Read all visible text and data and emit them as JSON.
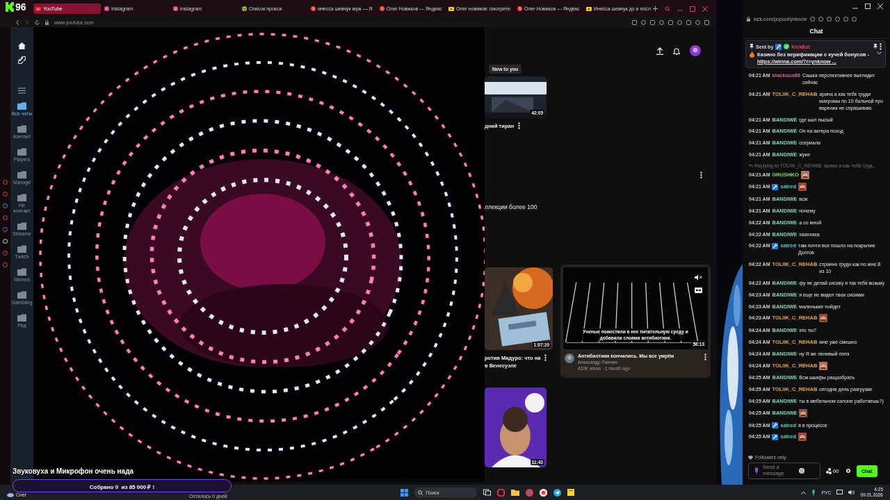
{
  "stream_overlay": {
    "viewers": "96",
    "goal_title": "Звуковуха и Микрофон очень нада",
    "goal_bar": {
      "text": "Собрано 0  из 85 000 ₽ !",
      "level": 0
    },
    "goal_remaining": "Осталось 0 дней"
  },
  "browser": {
    "tabs": [
      {
        "kind": "youtube",
        "label": "YouTube",
        "selected": true
      },
      {
        "kind": "instagram",
        "label": "Instagram",
        "selected": false
      },
      {
        "kind": "instagram",
        "label": "Instagram",
        "selected": false
      },
      {
        "kind": "proxy",
        "label": "Список прокси",
        "selected": false
      },
      {
        "kind": "yandex",
        "label": "инесса шевчук муж — Я",
        "selected": false
      },
      {
        "kind": "yandex",
        "label": "Олег Новиков — Яндекс",
        "selected": false
      },
      {
        "kind": "video",
        "label": "Олег новиков: смотрите",
        "selected": false
      },
      {
        "kind": "yandex",
        "label": "Олег Новиков — Яндекс",
        "selected": false
      },
      {
        "kind": "video",
        "label": "Инесса шевчук до и посл",
        "selected": false
      }
    ],
    "address": "www.youtube.com"
  },
  "messenger_sidebar": {
    "folders": [
      {
        "label": "Все чаты",
        "selected": true
      },
      {
        "label": "Контакт",
        "selected": false
      },
      {
        "label": "Players",
        "selected": false
      },
      {
        "label": "Manage",
        "selected": false
      },
      {
        "label": "Не контакт",
        "selected": false
      },
      {
        "label": "Streame",
        "selected": false
      },
      {
        "label": "Twitch",
        "selected": false
      },
      {
        "label": "Memes",
        "selected": false
      },
      {
        "label": "Gambling",
        "selected": false
      },
      {
        "label": "Ред",
        "selected": false
      }
    ]
  },
  "youtube": {
    "chip": "New to you",
    "videos": [
      {
        "duration": "42:05",
        "title_lines": [
          "дний тиран"
        ]
      },
      {
        "duration": "1:07:20",
        "title_lines": [
          "ротив Мадуро: что на",
          "в Венесуэле"
        ]
      },
      {
        "duration": "11:43"
      }
    ],
    "partial_text": "ллекции более 100",
    "hover_card": {
      "caption": "Ученые поместили в нее питательную среду и добавили слоями антибиотики.",
      "duration": "56:13",
      "title": "Антибиотики кончились. Мы все умрём",
      "channel": "Александр Панчин",
      "meta": "410K views · 1 month ago"
    }
  },
  "chat_window": {
    "address": "kick.com/popout/ynknow",
    "title": "Chat",
    "pinned": {
      "label": "Sent by",
      "sender": "KickBot",
      "text": "Казино без верификации с кучей бонусов - ",
      "link": "https://winna.com/?r=ynknow ..."
    },
    "messages": [
      {
        "kind": "text",
        "time": "04:21 AM",
        "user": "blacksus66",
        "color": "#d9608e",
        "badge": false,
        "text": "Сашка перспективнее выглядит сейчас"
      },
      {
        "kind": "text",
        "time": "04:21 AM",
        "user": "TOLIIK_C_REHAB",
        "color": "#e6a23c",
        "badge": false,
        "text": "арина а как тебе груди махромы по 10 бальной про вареник не спрашиваю"
      },
      {
        "kind": "text",
        "time": "04:21 AM",
        "user": "BANDIWE",
        "color": "#7fd8b4",
        "badge": false,
        "text": "где ьыл лысый"
      },
      {
        "kind": "text",
        "time": "04:21 AM",
        "user": "BANDIWE",
        "color": "#7fd8b4",
        "badge": false,
        "text": "Он на актера поход"
      },
      {
        "kind": "text",
        "time": "04:21 AM",
        "user": "BANDIWE",
        "color": "#7fd8b4",
        "badge": false,
        "text": "ссериала"
      },
      {
        "kind": "text",
        "time": "04:21 AM",
        "user": "BANDIWE",
        "color": "#7fd8b4",
        "badge": false,
        "text": "жуки"
      },
      {
        "kind": "emote",
        "time": "04:21 AM",
        "user": "GRUSHKO",
        "color": "#7ed957",
        "badge": false,
        "reply": "Replying to TOLIIK_C_REHAB: арина а как тебе груд..."
      },
      {
        "kind": "emote",
        "time": "04:21 AM",
        "user": "satred",
        "color": "#4ccfc8",
        "badge": true
      },
      {
        "kind": "text",
        "time": "04:21 AM",
        "user": "BANDIWE",
        "color": "#7fd8b4",
        "badge": false,
        "text": "всм"
      },
      {
        "kind": "text",
        "time": "04:21 AM",
        "user": "BANDIWE",
        "color": "#7fd8b4",
        "badge": false,
        "text": "почему"
      },
      {
        "kind": "text",
        "time": "04:22 AM",
        "user": "BANDIWE",
        "color": "#7fd8b4",
        "badge": false,
        "text": "а со мной"
      },
      {
        "kind": "text",
        "time": "04:22 AM",
        "user": "BANDIWE",
        "color": "#7fd8b4",
        "badge": false,
        "text": "хааххаха"
      },
      {
        "kind": "text",
        "time": "04:22 AM",
        "user": "satred",
        "color": "#4ccfc8",
        "badge": true,
        "text": "там почти все пошло на покрытие Долгов"
      },
      {
        "kind": "text",
        "time": "04:22 AM",
        "user": "TOLIIK_C_REHAB",
        "color": "#e6a23c",
        "badge": false,
        "text": "странно груди как по мне 8 из 10"
      },
      {
        "kind": "text",
        "time": "04:22 AM",
        "user": "BANDIWE",
        "color": "#7fd8b4",
        "badge": false,
        "text": "фу не делай сисику я так тебя возьму"
      },
      {
        "kind": "text",
        "time": "04:23 AM",
        "user": "BANDIWE",
        "color": "#7fd8b4",
        "badge": false,
        "text": "я еще не видел твои сисикки"
      },
      {
        "kind": "text",
        "time": "04:23 AM",
        "user": "BANDIWE",
        "color": "#7fd8b4",
        "badge": false,
        "text": "маленькие пойдет"
      },
      {
        "kind": "emote",
        "time": "04:23 AM",
        "user": "TOLIIK_C_REHAB",
        "color": "#e6a23c",
        "badge": false
      },
      {
        "kind": "text",
        "time": "04:24 AM",
        "user": "BANDIWE",
        "color": "#7fd8b4",
        "badge": false,
        "text": "это ты?"
      },
      {
        "kind": "text",
        "time": "04:24 AM",
        "user": "TOLIIK_C_REHAB",
        "color": "#e6a23c",
        "badge": false,
        "text": "мне уже смешно"
      },
      {
        "kind": "text",
        "time": "04:24 AM",
        "user": "BANDIWE",
        "color": "#7fd8b4",
        "badge": false,
        "text": "ну Я же ленивый пэпэ"
      },
      {
        "kind": "emote",
        "time": "04:24 AM",
        "user": "TOLIIK_C_REHAB",
        "color": "#e6a23c",
        "badge": false
      },
      {
        "kind": "text",
        "time": "04:25 AM",
        "user": "BANDIWE",
        "color": "#7fd8b4",
        "badge": false,
        "text": "Всм шкафы ращзобрать"
      },
      {
        "kind": "text",
        "time": "04:25 AM",
        "user": "TOLIIK_C_REHAB",
        "color": "#e6a23c",
        "badge": false,
        "text": "сегодня день разгрузки"
      },
      {
        "kind": "text",
        "time": "04:25 AM",
        "user": "BANDIWE",
        "color": "#7fd8b4",
        "badge": false,
        "text": "ты в мебельном салоне работаешь?)"
      },
      {
        "kind": "emote",
        "time": "04:25 AM",
        "user": "BANDIWE",
        "color": "#7fd8b4",
        "badge": false
      },
      {
        "kind": "text",
        "time": "04:25 AM",
        "user": "satred",
        "color": "#4ccfc8",
        "badge": true,
        "text": "я в процессе"
      },
      {
        "kind": "emote",
        "time": "04:25 AM",
        "user": "satred",
        "color": "#4ccfc8",
        "badge": true
      }
    ],
    "followers_notice": "Followers only",
    "input": {
      "placeholder": "Send a message"
    },
    "send_button": "Chat"
  },
  "taskbar": {
    "weather": "Снег",
    "search": "Поиск",
    "language": "РУС",
    "time": "4:25",
    "date": "09.01.2026"
  }
}
